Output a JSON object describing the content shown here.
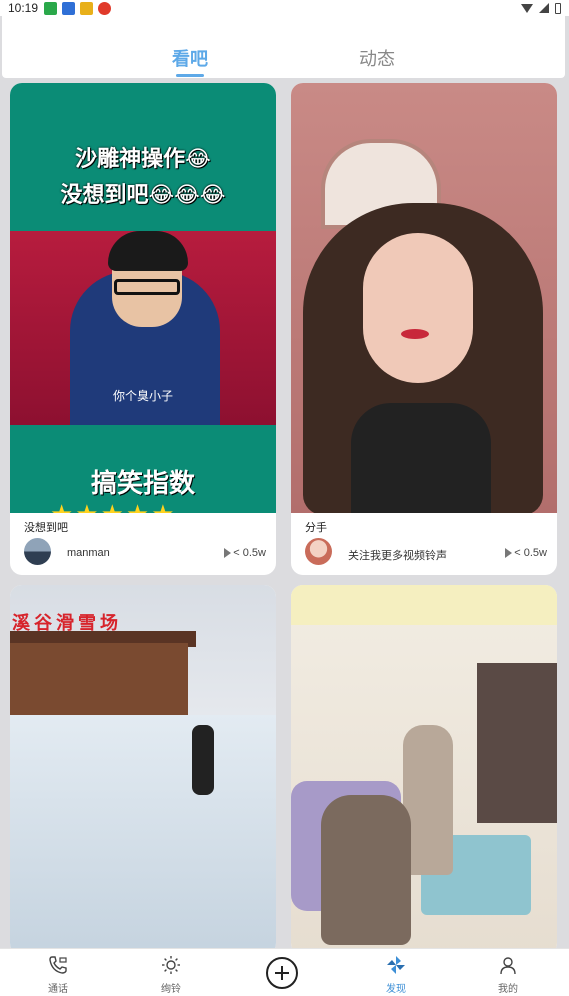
{
  "status_bar": {
    "time": "10:19"
  },
  "tabs": [
    {
      "label": "看吧",
      "active": true
    },
    {
      "label": "动态",
      "active": false
    }
  ],
  "cards": [
    {
      "title": "没想到吧",
      "author": "manman",
      "views": "< 0.5w",
      "thumb_text": {
        "line1": "沙雕神操作😂",
        "line2": "没想到吧😂😂😂",
        "subtitle": "你个臭小子",
        "rating": "搞笑指数",
        "stars": "★★★★★"
      }
    },
    {
      "title": "分手",
      "author": "关注我更多视频铃声",
      "views": "< 0.5w"
    },
    {
      "thumb_text": {
        "sign": "溪谷滑雪场"
      }
    },
    {}
  ],
  "bottom_nav": [
    {
      "label": "通话",
      "icon": "phone-icon",
      "active": false
    },
    {
      "label": "绚铃",
      "icon": "sun-icon",
      "active": false
    },
    {
      "label": "",
      "icon": "plus-icon",
      "active": false
    },
    {
      "label": "发现",
      "icon": "pinwheel-icon",
      "active": true
    },
    {
      "label": "我的",
      "icon": "user-icon",
      "active": false
    }
  ],
  "colors": {
    "accent": "#5ea9e8",
    "nav_active": "#3d8fd6",
    "meme_green": "#0b8c76"
  }
}
